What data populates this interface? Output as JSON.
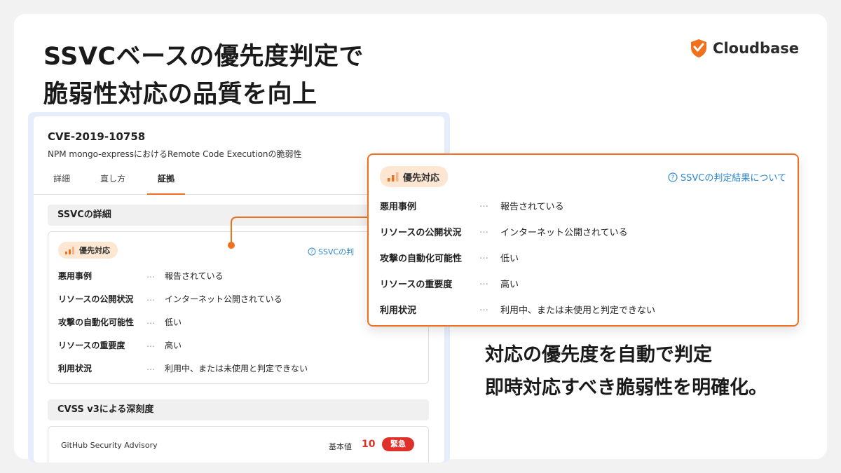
{
  "headline": {
    "line1": "SSVCベースの優先度判定で",
    "line2": "脆弱性対応の品質を向上"
  },
  "brand": {
    "name": "Cloudbase",
    "accent": "#f0701e"
  },
  "screenshot": {
    "cve_id": "CVE-2019-10758",
    "cve_description": "NPM mongo-expressにおけるRemote Code Executionの脆弱性",
    "tabs": [
      "詳細",
      "直し方",
      "証拠"
    ],
    "active_tab": "証拠",
    "section_ssvc": "SSVCの詳細",
    "section_cvss": "CVSS v3による深刻度",
    "cvss": {
      "source": "GitHub Security Advisory",
      "base_label": "基本値",
      "base_value": "10",
      "severity": "緊急"
    }
  },
  "ssvc": {
    "priority_label": "優先対応",
    "link_label": "SSVCの判定結果について",
    "link_label_clipped": "SSVCの判",
    "rows": [
      {
        "label": "悪用事例",
        "value": "報告されている"
      },
      {
        "label": "リソースの公開状況",
        "value": "インターネット公開されている"
      },
      {
        "label": "攻撃の自動化可能性",
        "value": "低い"
      },
      {
        "label": "リソースの重要度",
        "value": "高い"
      },
      {
        "label": "利用状況",
        "value": "利用中、または未使用と判定できない"
      }
    ],
    "dots": "…"
  },
  "tagline": {
    "line1": "対応の優先度を自動で判定",
    "line2": "即時対応すべき脆弱性を明確化。"
  },
  "colors": {
    "accent": "#f0701e",
    "link": "#2e86d0",
    "badge_bg": "#fde6d2",
    "urgent": "#e0302a"
  }
}
